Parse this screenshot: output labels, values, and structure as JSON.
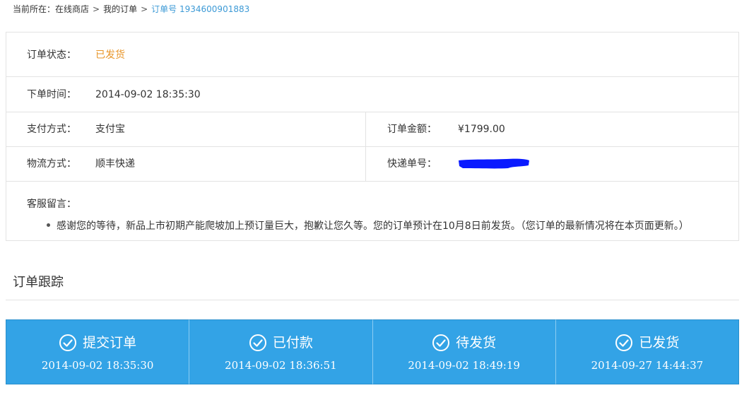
{
  "breadcrumb": {
    "prefix": "当前所在：",
    "items": [
      "在线商店",
      "我的订单"
    ],
    "separator": ">",
    "current": "订单号 1934600901883"
  },
  "order": {
    "status_label": "订单状态：",
    "status_value": "已发货",
    "time_label": "下单时间：",
    "time_value": "2014-09-02 18:35:30",
    "payment_label": "支付方式：",
    "payment_value": "支付宝",
    "amount_label": "订单金额：",
    "amount_value": "¥1799.00",
    "logistics_label": "物流方式：",
    "logistics_value": "顺丰快递",
    "tracking_label": "快递单号：",
    "tracking_value": "",
    "note_label": "客服留言：",
    "note_text": "感谢您的等待，新品上市初期产能爬坡加上预订量巨大，抱歉让您久等。您的订单预计在10月8日前发货。（您订单的最新情况将在本页面更新。）"
  },
  "tracking": {
    "title": "订单跟踪",
    "steps": [
      {
        "name": "提交订单",
        "time": "2014-09-02 18:35:30",
        "icon": "check-circle-icon"
      },
      {
        "name": "已付款",
        "time": "2014-09-02 18:36:51",
        "icon": "check-circle-icon"
      },
      {
        "name": "待发货",
        "time": "2014-09-02 18:49:19",
        "icon": "check-circle-icon"
      },
      {
        "name": "已发货",
        "time": "2014-09-27 14:44:37",
        "icon": "check-circle-icon"
      }
    ]
  },
  "colors": {
    "accent": "#33a3e6",
    "link": "#3d9ad6",
    "status": "#e8962a",
    "redaction": "#0a1aff",
    "border": "#e3e3e3"
  }
}
